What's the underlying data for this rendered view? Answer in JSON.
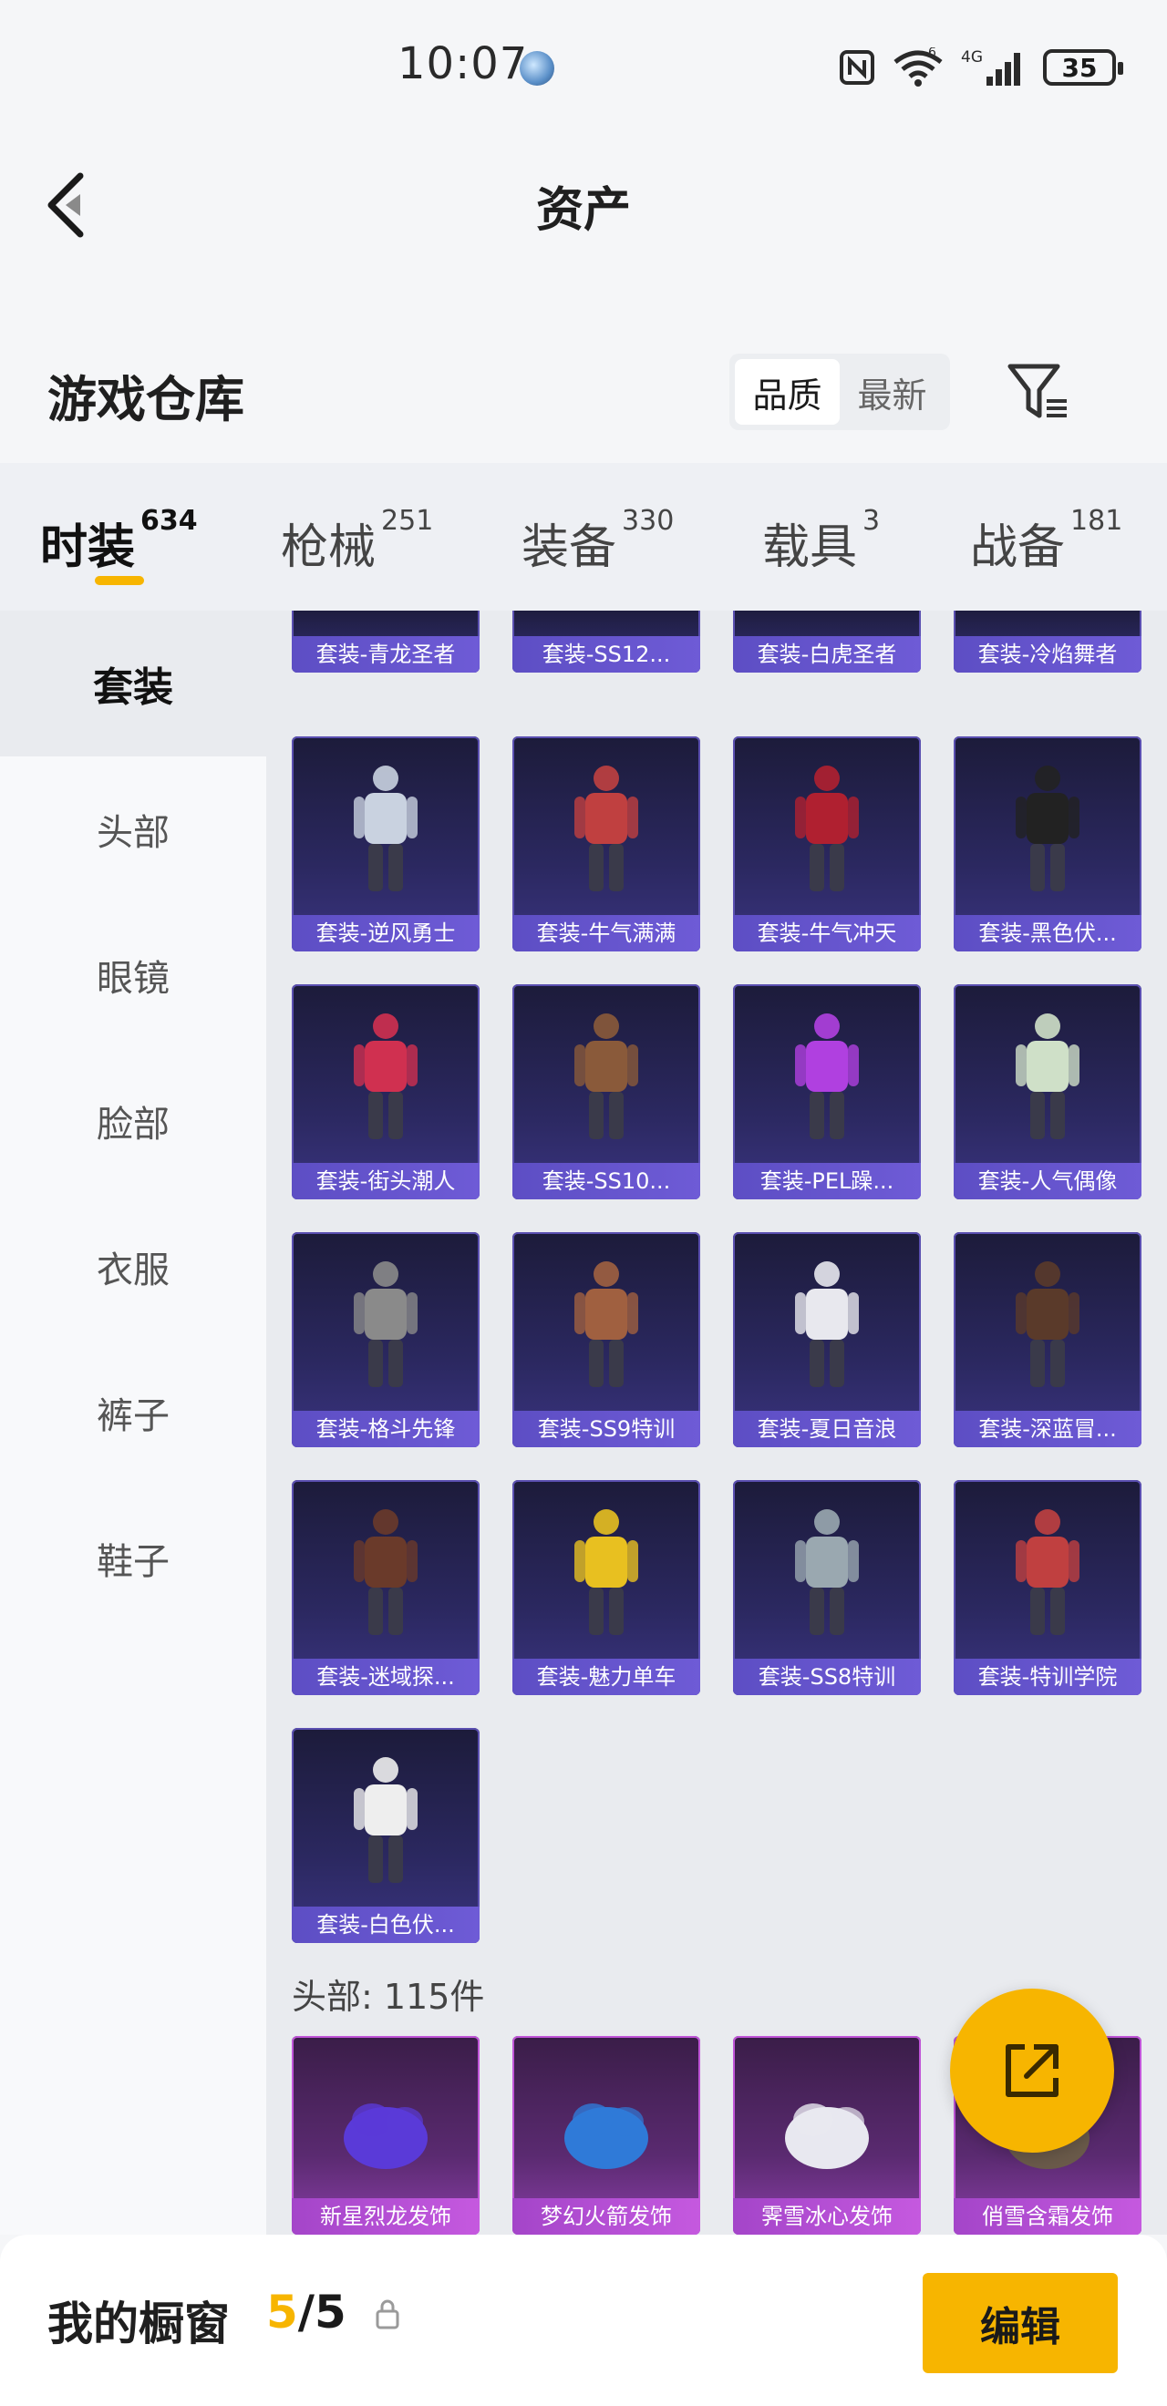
{
  "status_bar": {
    "time": "10:07",
    "signal_text": "4G",
    "wifi_badge": "6",
    "battery": "35"
  },
  "header": {
    "title": "资产"
  },
  "section": {
    "title": "游戏仓库",
    "sort_options": [
      "品质",
      "最新"
    ],
    "active_sort": "品质"
  },
  "tabs": [
    {
      "label": "时装",
      "count": "634",
      "active": true
    },
    {
      "label": "枪械",
      "count": "251",
      "active": false
    },
    {
      "label": "装备",
      "count": "330",
      "active": false
    },
    {
      "label": "载具",
      "count": "3",
      "active": false
    },
    {
      "label": "战备",
      "count": "181",
      "active": false
    }
  ],
  "sidebar": {
    "items": [
      "套装",
      "头部",
      "眼镜",
      "脸部",
      "衣服",
      "裤子",
      "鞋子"
    ],
    "active": "套装"
  },
  "grid": {
    "partial_row": [
      "套装-青龙圣者",
      "套装-SS12...",
      "套装-白虎圣者",
      "套装-冷焰舞者"
    ],
    "outfits": [
      "套装-逆风勇士",
      "套装-牛气满满",
      "套装-牛气冲天",
      "套装-黑色伏...",
      "套装-街头潮人",
      "套装-SS10...",
      "套装-PEL躁...",
      "套装-人气偶像",
      "套装-格斗先锋",
      "套装-SS9特训",
      "套装-夏日音浪",
      "套装-深蓝冒...",
      "套装-迷域探...",
      "套装-魅力单车",
      "套装-SS8特训",
      "套装-特训学院",
      "套装-白色伏..."
    ],
    "head_section_label": "头部: 115件",
    "head_items": [
      "新星烈龙发饰",
      "梦幻火箭发饰",
      "霁雪冰心发饰",
      "俏雪含霜发饰"
    ]
  },
  "showcase": {
    "title": "我的橱窗",
    "current": "5",
    "total": "/5",
    "edit_label": "编辑"
  },
  "colors": {
    "accent": "#f7b500",
    "card_label": "#6e5bd6",
    "head_card_label": "#c559df"
  }
}
